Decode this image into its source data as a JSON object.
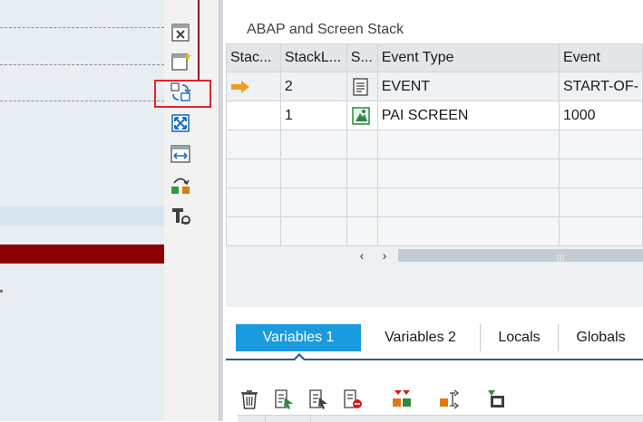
{
  "stack_panel": {
    "title": "ABAP and Screen Stack",
    "columns": [
      "Stac...",
      "StackL...",
      "S...",
      "Event Type",
      "Event"
    ],
    "rows": [
      {
        "level": "2",
        "event_type": "EVENT",
        "event": "START-OF-",
        "type_icon": "event-document-icon",
        "current": true
      },
      {
        "level": "1",
        "event_type": "PAI SCREEN",
        "event": "1000",
        "type_icon": "screen-icon",
        "current": false
      }
    ]
  },
  "tabs": [
    {
      "label": "Variables 1",
      "active": true
    },
    {
      "label": "Variables 2",
      "active": false
    },
    {
      "label": "Locals",
      "active": false
    },
    {
      "label": "Globals",
      "active": false
    }
  ],
  "colors": {
    "active_tab": "#1a9be0",
    "current_arrow": "#f0a020",
    "highlight": "#e3242b",
    "error_row": "#8b0000"
  },
  "vertical_toolbar": [
    "close-tool-icon",
    "new-tool-icon",
    "replace-tool-icon",
    "maximize-tool-icon",
    "full-width-icon",
    "swap-tools-icon",
    "tool-settings-icon"
  ],
  "bottom_toolbar": [
    "delete-icon",
    "select-variable-icon",
    "variable-details-icon",
    "delete-watchpoint-icon",
    "compare-icon",
    "change-value-icon",
    "save-variable-icon"
  ]
}
